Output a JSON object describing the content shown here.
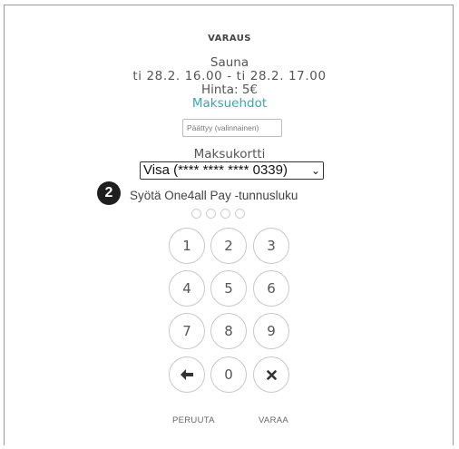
{
  "reservation": {
    "title": "VARAUS",
    "service": "Sauna",
    "time_range": "ti 28.2. 16.00 - ti 28.2. 17.00",
    "price": "Hinta: 5€",
    "terms_link": "Maksuehdot",
    "end_field": {
      "placeholder": "Päättyy (valinnainen)",
      "value": ""
    }
  },
  "payment": {
    "card_label": "Maksukortti",
    "card_selected": "Visa (**** **** **** 0339)",
    "step_badge": "2",
    "pin_prompt": "Syötä One4all Pay -tunnusluku",
    "pin_entered_digits": 0,
    "pin_length": 4
  },
  "keypad": {
    "keys": [
      "1",
      "2",
      "3",
      "4",
      "5",
      "6",
      "7",
      "8",
      "9",
      "0"
    ],
    "backspace_icon": "arrow-left-icon",
    "clear_icon": "x-icon"
  },
  "actions": {
    "cancel_label": "PERUUTA",
    "reserve_label": "VARAA"
  },
  "colors": {
    "accent": "#3aa6b0",
    "badge": "#1f1f1f"
  }
}
